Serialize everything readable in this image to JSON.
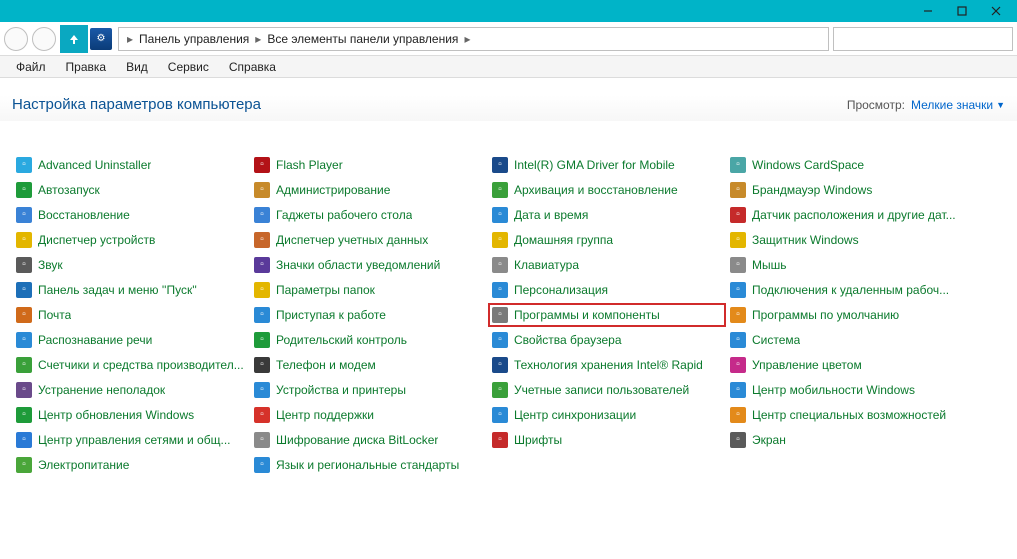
{
  "window": {
    "minimize": "–",
    "maximize": "☐",
    "close": "✕"
  },
  "breadcrumb": {
    "item1": "Панель управления",
    "item2": "Все элементы панели управления"
  },
  "menubar": {
    "file": "Файл",
    "edit": "Правка",
    "view": "Вид",
    "tools": "Сервис",
    "help": "Справка"
  },
  "header": {
    "title": "Настройка параметров компьютера",
    "view_label": "Просмотр:",
    "view_value": "Мелкие значки"
  },
  "items": {
    "c0": [
      {
        "label": "Advanced Uninstaller",
        "icon": "trash",
        "bg": "#2aa9e0"
      },
      {
        "label": "Автозапуск",
        "icon": "play",
        "bg": "#1e9b3a"
      },
      {
        "label": "Восстановление",
        "icon": "undo",
        "bg": "#3a82d6"
      },
      {
        "label": "Диспетчер устройств",
        "icon": "pci",
        "bg": "#e3b600"
      },
      {
        "label": "Звук",
        "icon": "speaker",
        "bg": "#5a5a5a"
      },
      {
        "label": "Панель задач и меню ''Пуск''",
        "icon": "taskbar",
        "bg": "#1d6fb8"
      },
      {
        "label": "Почта",
        "icon": "mail",
        "bg": "#d06a1a"
      },
      {
        "label": "Распознавание речи",
        "icon": "mic",
        "bg": "#2a8ad6"
      },
      {
        "label": "Счетчики и средства производител...",
        "icon": "gauge",
        "bg": "#3aa03a"
      },
      {
        "label": "Устранение неполадок",
        "icon": "tools",
        "bg": "#6a4a8a"
      },
      {
        "label": "Центр обновления Windows",
        "icon": "update",
        "bg": "#1e9b3a"
      },
      {
        "label": "Центр управления сетями и общ...",
        "icon": "network",
        "bg": "#2a7ad6"
      },
      {
        "label": "Электропитание",
        "icon": "power",
        "bg": "#4aa63a"
      }
    ],
    "c1": [
      {
        "label": "Flash Player",
        "icon": "flash",
        "bg": "#b31217"
      },
      {
        "label": "Администрирование",
        "icon": "admin",
        "bg": "#c78a2a"
      },
      {
        "label": "Гаджеты рабочего стола",
        "icon": "gadget",
        "bg": "#3a82d6"
      },
      {
        "label": "Диспетчер учетных данных",
        "icon": "cred",
        "bg": "#c7662a"
      },
      {
        "label": "Значки области уведомлений",
        "icon": "tray",
        "bg": "#5a3a9a"
      },
      {
        "label": "Параметры папок",
        "icon": "folder",
        "bg": "#e3b600"
      },
      {
        "label": "Приступая к работе",
        "icon": "start",
        "bg": "#2a8ad6"
      },
      {
        "label": "Родительский контроль",
        "icon": "parent",
        "bg": "#1e9b3a"
      },
      {
        "label": "Телефон и модем",
        "icon": "phone",
        "bg": "#3a3a3a"
      },
      {
        "label": "Устройства и принтеры",
        "icon": "printer",
        "bg": "#2a8ad6"
      },
      {
        "label": "Центр поддержки",
        "icon": "support",
        "bg": "#d6322a"
      },
      {
        "label": "Шифрование диска BitLocker",
        "icon": "bitlocker",
        "bg": "#8a8a8a"
      },
      {
        "label": "Язык и региональные стандарты",
        "icon": "globe",
        "bg": "#2a8ad6"
      }
    ],
    "c2": [
      {
        "label": "Intel(R) GMA Driver for Mobile",
        "icon": "intel",
        "bg": "#1a4a8a"
      },
      {
        "label": "Архивация и восстановление",
        "icon": "backup",
        "bg": "#3aa03a"
      },
      {
        "label": "Дата и время",
        "icon": "clock",
        "bg": "#2a8ad6"
      },
      {
        "label": "Домашняя группа",
        "icon": "home",
        "bg": "#e3b600"
      },
      {
        "label": "Клавиатура",
        "icon": "kbd",
        "bg": "#8a8a8a"
      },
      {
        "label": "Персонализация",
        "icon": "person",
        "bg": "#2a8ad6"
      },
      {
        "label": "Программы и компоненты",
        "icon": "programs",
        "bg": "#7a7a7a",
        "highlight": true
      },
      {
        "label": "Свойства браузера",
        "icon": "browser",
        "bg": "#2a8ad6"
      },
      {
        "label": "Технология хранения Intel® Rapid",
        "icon": "rapid",
        "bg": "#1a4a8a"
      },
      {
        "label": "Учетные записи пользователей",
        "icon": "users",
        "bg": "#3aa03a"
      },
      {
        "label": "Центр синхронизации",
        "icon": "sync",
        "bg": "#2a8ad6"
      },
      {
        "label": "Шрифты",
        "icon": "font",
        "bg": "#c52a2a"
      }
    ],
    "c3": [
      {
        "label": "Windows CardSpace",
        "icon": "card",
        "bg": "#4aa6a6"
      },
      {
        "label": "Брандмауэр Windows",
        "icon": "fw",
        "bg": "#c78a2a"
      },
      {
        "label": "Датчик расположения и другие дат...",
        "icon": "sensor",
        "bg": "#c52a2a"
      },
      {
        "label": "Защитник Windows",
        "icon": "defender",
        "bg": "#e3b600"
      },
      {
        "label": "Мышь",
        "icon": "mouse",
        "bg": "#8a8a8a"
      },
      {
        "label": "Подключения к удаленным рабоч...",
        "icon": "rdp",
        "bg": "#2a8ad6"
      },
      {
        "label": "Программы по умолчанию",
        "icon": "default",
        "bg": "#e38a1a"
      },
      {
        "label": "Система",
        "icon": "system",
        "bg": "#2a8ad6"
      },
      {
        "label": "Управление цветом",
        "icon": "color",
        "bg": "#c52a8a"
      },
      {
        "label": "Центр мобильности Windows",
        "icon": "mobility",
        "bg": "#2a8ad6"
      },
      {
        "label": "Центр специальных возможностей",
        "icon": "ease",
        "bg": "#e38a1a"
      },
      {
        "label": "Экран",
        "icon": "display",
        "bg": "#5a5a5a"
      }
    ]
  }
}
